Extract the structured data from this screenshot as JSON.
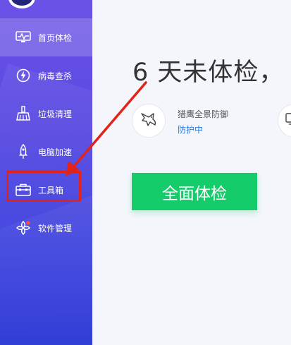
{
  "sidebar": {
    "items": [
      {
        "label": "首页体检",
        "icon": "monitor-heartbeat-icon",
        "active": true
      },
      {
        "label": "病毒查杀",
        "icon": "lightning-shield-icon",
        "active": false
      },
      {
        "label": "垃圾清理",
        "icon": "broom-icon",
        "active": false
      },
      {
        "label": "电脑加速",
        "icon": "rocket-icon",
        "active": false
      },
      {
        "label": "工具箱",
        "icon": "toolbox-icon",
        "active": false,
        "highlighted": true
      },
      {
        "label": "软件管理",
        "icon": "apps-icon",
        "active": false
      }
    ]
  },
  "main": {
    "headline": "6 天未体检，",
    "protection": {
      "title": "猎鹰全景防御",
      "status": "防护中"
    },
    "scan_button_label": "全面体检"
  },
  "colors": {
    "sidebar_top": "#6b52e6",
    "sidebar_bottom": "#2c39d6",
    "scan_button": "#15cc6b",
    "status_text": "#2a7be4",
    "annotation_red": "#e2231a"
  }
}
